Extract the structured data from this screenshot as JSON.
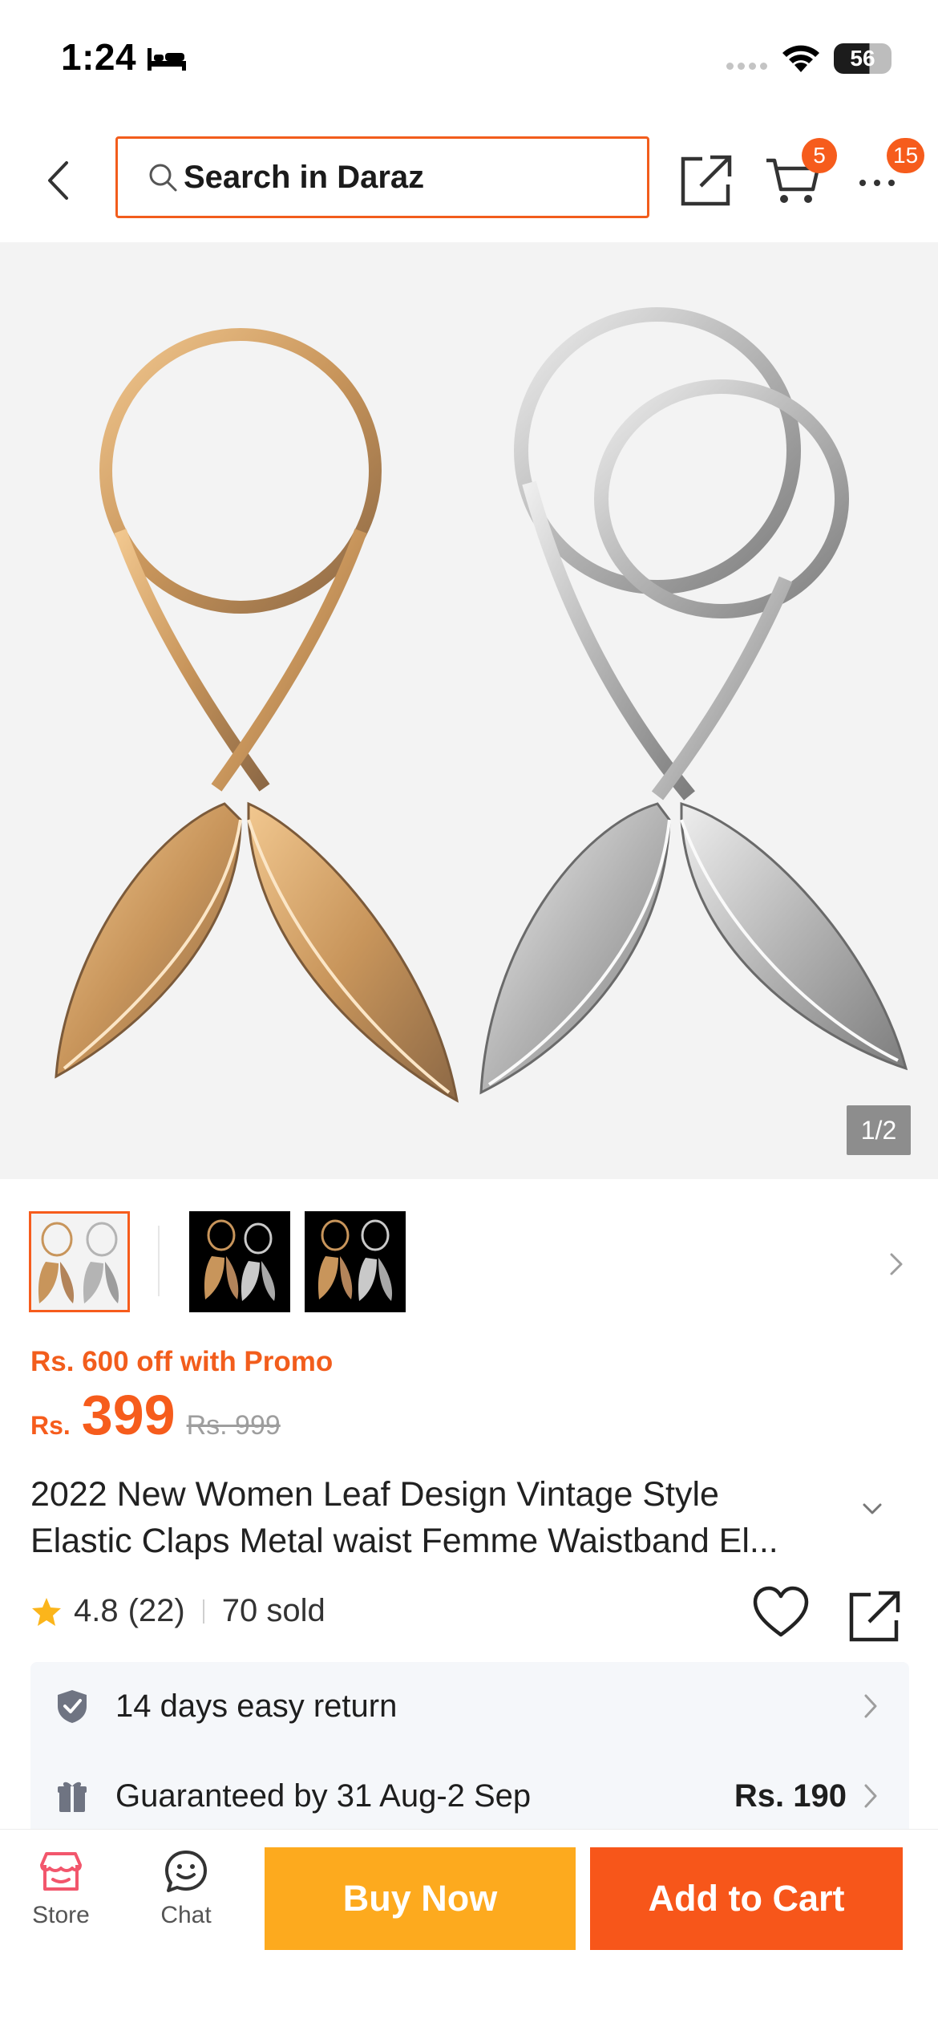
{
  "status_bar": {
    "time": "1:24",
    "battery": "56"
  },
  "header": {
    "search_placeholder": "Search in Daraz",
    "cart_badge": "5",
    "more_badge": "15"
  },
  "gallery": {
    "counter": "1/2"
  },
  "price": {
    "promo": "Rs. 600 off with Promo",
    "currency": "Rs.",
    "current": "399",
    "original": "Rs. 999"
  },
  "product": {
    "title_line1": "2022 New Women Leaf Design Vintage Style",
    "title_line2": "Elastic Claps Metal waist Femme Waistband El..."
  },
  "rating": {
    "score": "4.8",
    "reviews": "(22)",
    "sold": "70 sold"
  },
  "services": {
    "return_label": "14 days easy return",
    "delivery_label": "Guaranteed by 31 Aug-2 Sep",
    "delivery_fee": "Rs. 190"
  },
  "bottom_bar": {
    "store_label": "Store",
    "chat_label": "Chat",
    "buy_now": "Buy Now",
    "add_to_cart": "Add to Cart"
  },
  "colors": {
    "accent": "#f65c1c",
    "buy_now": "#fdaa1e",
    "add_to_cart": "#f7561a",
    "store_icon": "#f2566c"
  }
}
